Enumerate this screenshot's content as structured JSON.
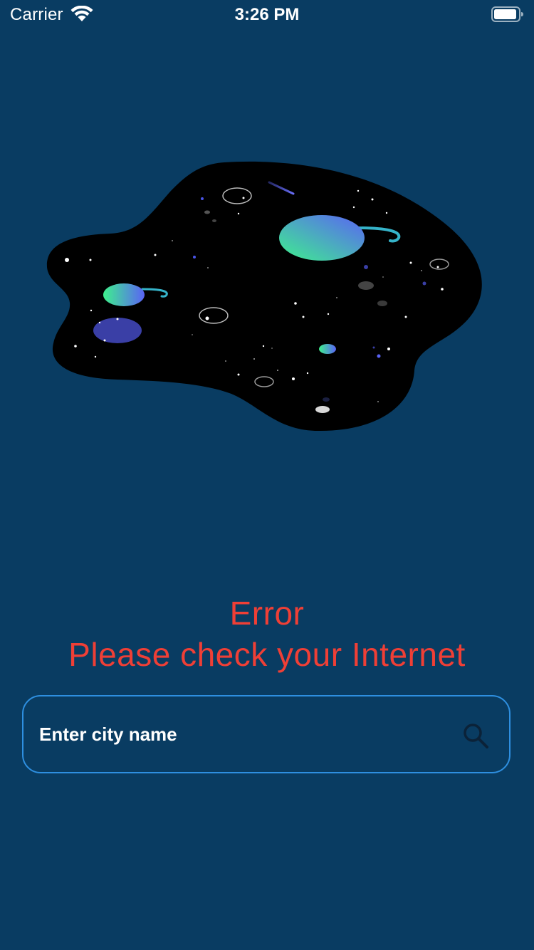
{
  "status_bar": {
    "carrier": "Carrier",
    "time": "3:26 PM"
  },
  "illustration": {
    "icon": "space-planets-illustration"
  },
  "error": {
    "line1": "Error",
    "line2": "Please check your Internet",
    "color": "#ef3f36"
  },
  "search": {
    "placeholder": "Enter city name",
    "value": "",
    "icon": "search-icon",
    "border_color": "#2e8fe0"
  },
  "colors": {
    "background": "#093c62",
    "text": "#ffffff"
  }
}
